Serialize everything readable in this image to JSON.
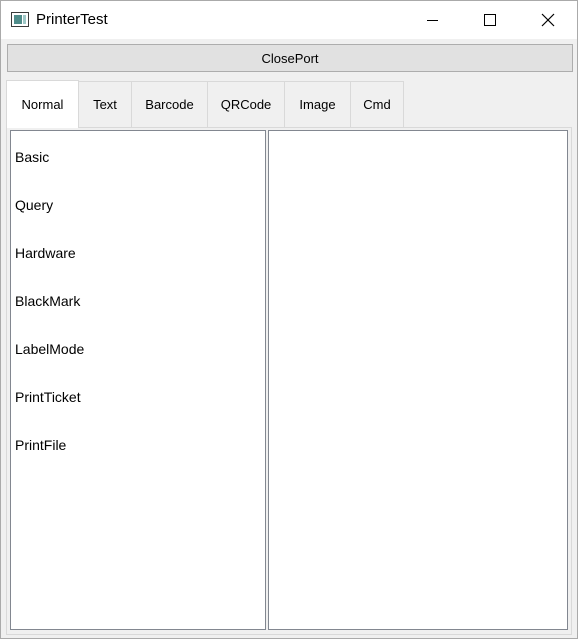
{
  "window": {
    "title": "PrinterTest",
    "icon": "app-window-icon"
  },
  "titlebar_buttons": {
    "minimize_icon": "minimize-icon",
    "maximize_icon": "maximize-icon",
    "close_icon": "close-icon"
  },
  "toolbar": {
    "close_port_label": "ClosePort"
  },
  "tabs": [
    {
      "label": "Normal",
      "active": true
    },
    {
      "label": "Text",
      "active": false
    },
    {
      "label": "Barcode",
      "active": false
    },
    {
      "label": "QRCode",
      "active": false
    },
    {
      "label": "Image",
      "active": false
    },
    {
      "label": "Cmd",
      "active": false
    }
  ],
  "normal_list": {
    "items": [
      "Basic",
      "Query",
      "Hardware",
      "BlackMark",
      "LabelMode",
      "PrintTicket",
      "PrintFile"
    ]
  }
}
